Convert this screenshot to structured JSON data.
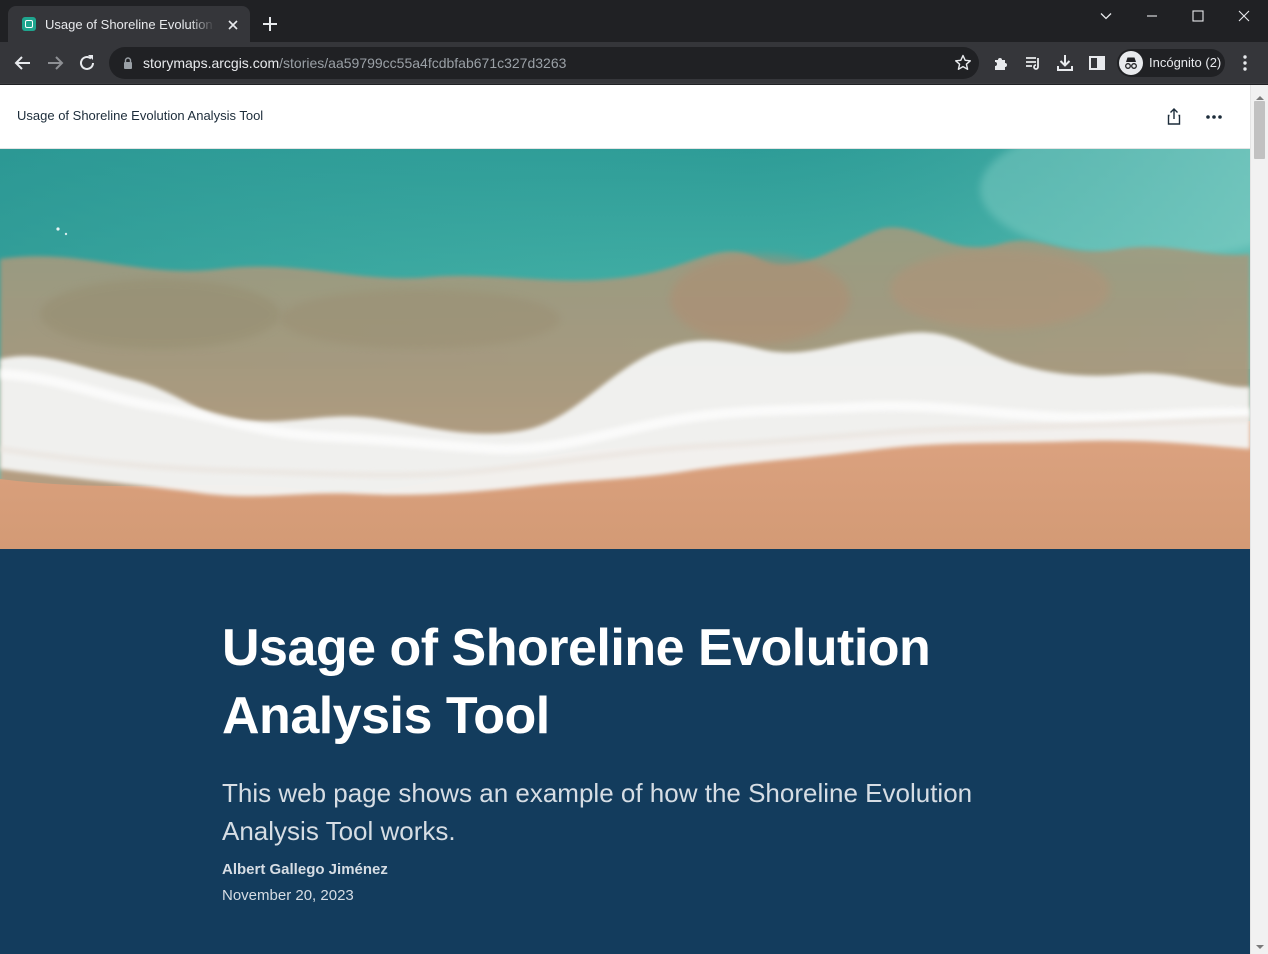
{
  "browser": {
    "tab": {
      "title": "Usage of Shoreline Evolution Analysis Tool",
      "favicon": "storymaps-icon"
    },
    "address_bar": {
      "domain": "storymaps.arcgis.com",
      "path": "/stories/aa59799cc55a4fcdbfab671c327d3263"
    },
    "profile": {
      "label": "Incógnito (2)"
    },
    "toolbar_icons": [
      "back-icon",
      "forward-icon",
      "reload-icon",
      "lock-icon",
      "bookmark-star-icon",
      "extensions-icon",
      "reading-list-icon",
      "download-icon",
      "side-panel-icon",
      "incognito-icon",
      "menu-kebab-icon"
    ],
    "window_controls": [
      "tab-search-icon",
      "minimize-icon",
      "maximize-icon",
      "close-window-icon"
    ]
  },
  "story": {
    "header": {
      "title": "Usage of Shoreline Evolution Analysis Tool",
      "icons": [
        "share-icon",
        "more-options-icon"
      ]
    },
    "cover": {
      "title": "Usage of Shoreline Evolution Analysis Tool",
      "subtitle": "This web page shows an example of how the Shoreline Evolution Analysis Tool works.",
      "author": "Albert Gallego Jiménez",
      "date": "November 20, 2023"
    }
  },
  "colors": {
    "chrome_dark": "#202124",
    "chrome_toolbar": "#35363a",
    "cover_background": "#133c5d",
    "cover_text": "#ffffff",
    "cover_subtext": "#d6dde4"
  }
}
